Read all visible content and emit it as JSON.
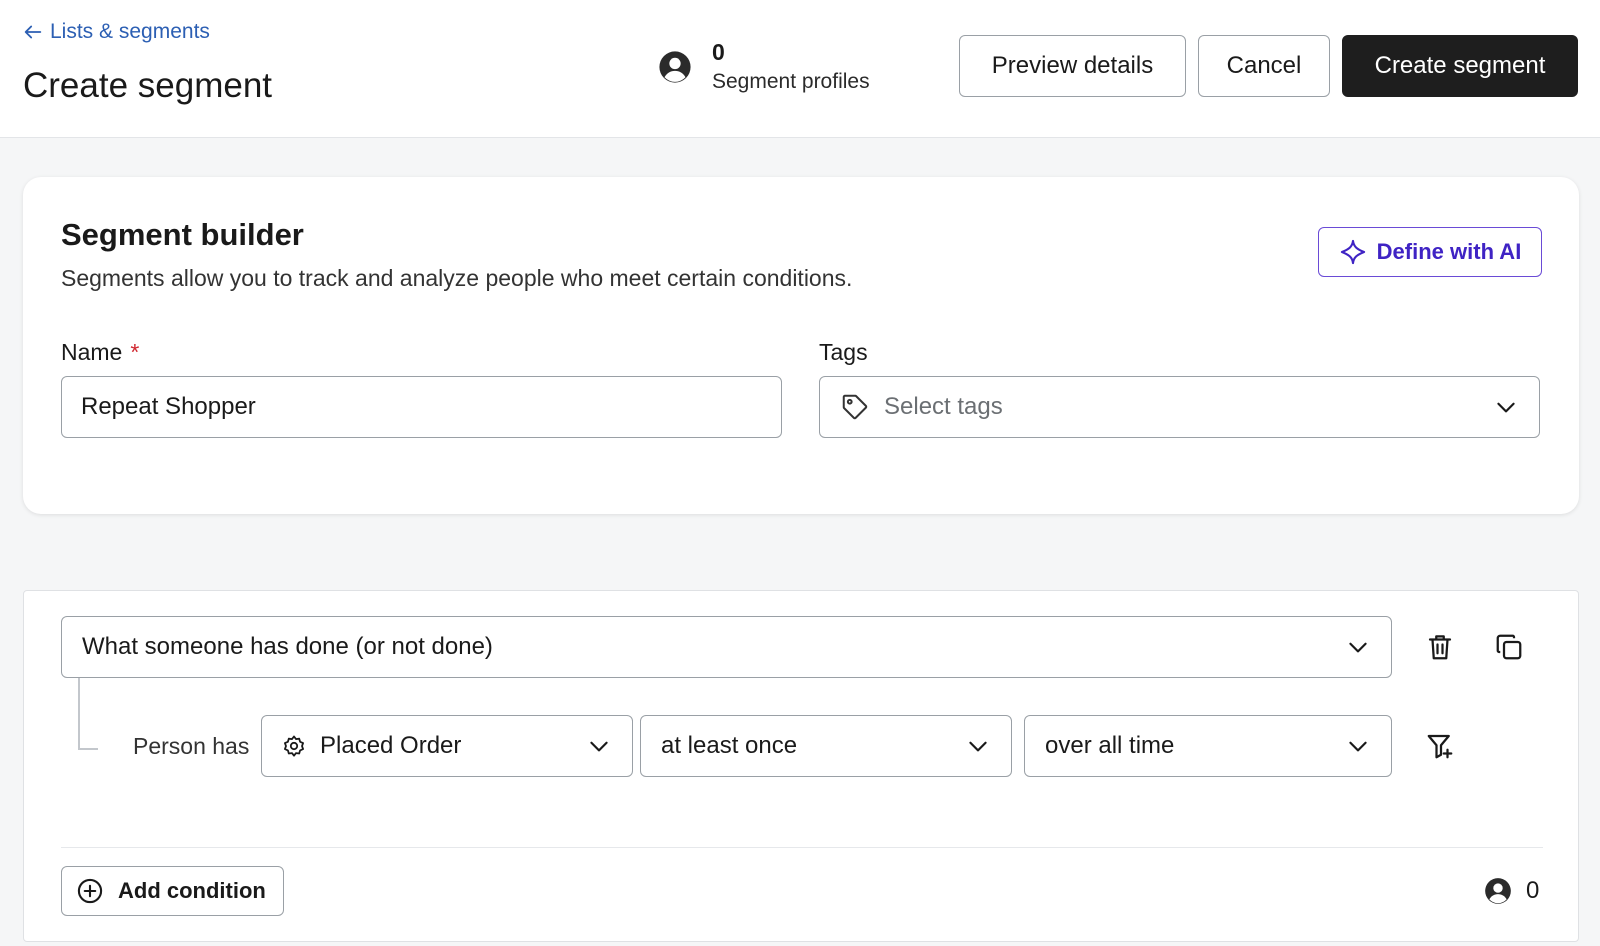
{
  "header": {
    "back_link": "Lists & segments",
    "title": "Create segment",
    "profile_count": "0",
    "profile_label": "Segment profiles",
    "preview_label": "Preview details",
    "cancel_label": "Cancel",
    "create_label": "Create segment"
  },
  "builder": {
    "title": "Segment builder",
    "description": "Segments allow you to track and analyze people who meet certain conditions.",
    "ai_label": "Define with AI",
    "name_label": "Name",
    "required_mark": "*",
    "name_value": "Repeat Shopper",
    "tags_label": "Tags",
    "tags_placeholder": "Select tags"
  },
  "condition": {
    "type_value": "What someone has done (or not done)",
    "person_has_label": "Person has",
    "metric_value": "Placed Order",
    "frequency_value": "at least once",
    "timeframe_value": "over all time",
    "add_condition_label": "Add condition",
    "count": "0"
  },
  "colors": {
    "link": "#2c5fb3",
    "primary_button": "#1e1e1e",
    "ai_accent": "#3f23c4",
    "required": "#d0272f"
  },
  "icons": {
    "back": "arrow-left-icon",
    "avatar": "user-circle-icon",
    "ai": "sparkle-icon",
    "tag": "tag-icon",
    "chevron": "chevron-down-icon",
    "trash": "trash-icon",
    "copy": "copy-icon",
    "filter": "filter-plus-icon",
    "gear": "gear-icon",
    "add": "plus-circle-icon"
  }
}
